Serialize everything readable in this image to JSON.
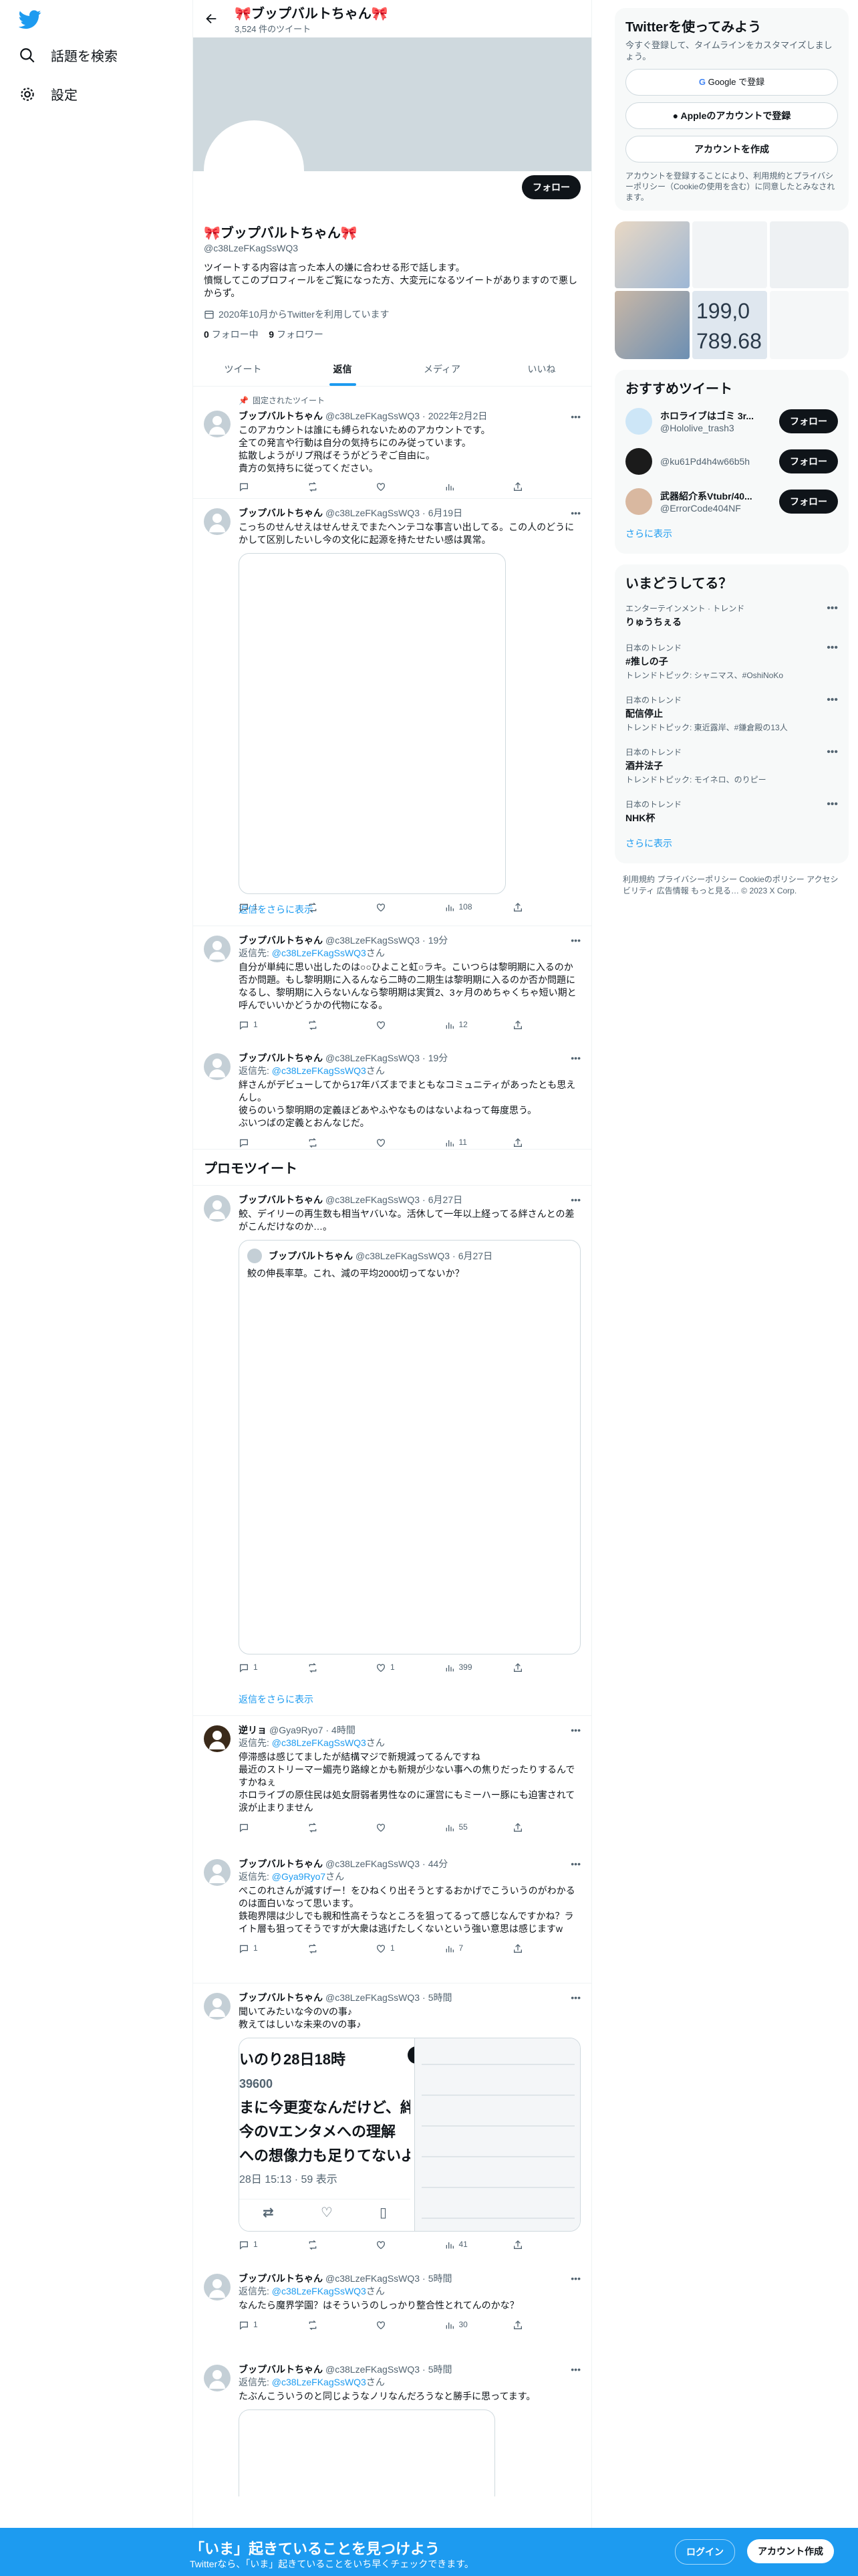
{
  "nav": {
    "explore": "話題を検索",
    "settings": "設定"
  },
  "header": {
    "name": "🎀ブップバルトちゃん🎀",
    "tweet_count": "3,524 件のツイート"
  },
  "profile": {
    "name": "🎀ブップバルトちゃん🎀",
    "handle": "@c38LzeFKagSsWQ3",
    "follow_button": "フォロー",
    "bio": "ツイートする内容は言った本人の嫌に合わせる形で話します。\n憤慨してこのプロフィールをご覧になった方、大変元になるツイートがありますので悪しからず。",
    "joined": "2020年10月からTwitterを利用しています",
    "following_count": "0",
    "following_label": "フォロー中",
    "followers_count": "9",
    "followers_label": "フォロワー"
  },
  "tabs": [
    "ツイート",
    "返信",
    "メディア",
    "いいね"
  ],
  "active_tab": "返信",
  "pinned_label": "固定されたツイート",
  "tweets": [
    {
      "name": "ブップバルトちゃん",
      "handle": "@c38LzeFKagSsWQ3",
      "time": "2022年2月2日",
      "reply_to": "",
      "text": "このアカウントは誰にも縛られないためのアカウントです。\n全ての発言や行動は自分の気持ちにのみ従っています。\n拡散しようがリプ飛ばそうがどうぞご自由に。\n貴方の気持ちに従ってください。",
      "replies": "",
      "retweets": "",
      "likes": "",
      "views": ""
    },
    {
      "name": "ブップバルトちゃん",
      "handle": "@c38LzeFKagSsWQ3",
      "time": "6月19日",
      "reply_to": "",
      "text": "こっちのせんせえはせんせえでまたヘンテコな事言い出してる。この人のどうにかして区別したいし今の文化に起源を持たせたい感は異常。",
      "replies": "1",
      "retweets": "",
      "likes": "",
      "views": "108"
    },
    {
      "name": "ブップバルトちゃん",
      "handle": "@c38LzeFKagSsWQ3",
      "time": "19分",
      "reply_to": "@c38LzeFKagSsWQ3",
      "text": "自分が単純に思い出したのは○○ひよこと虹○ラキ。こいつらは黎明期に入るのか否か問題。もし黎明期に入るんなら二時の二期生は黎明期に入るのか否か問題になるし、黎明期に入らないんなら黎明期は実質2、3ヶ月のめちゃくちゃ短い期と呼んでいいかどうかの代物になる。",
      "replies": "1",
      "retweets": "",
      "likes": "",
      "views": "12"
    },
    {
      "name": "ブップバルトちゃん",
      "handle": "@c38LzeFKagSsWQ3",
      "time": "19分",
      "reply_to": "@c38LzeFKagSsWQ3",
      "text": "絆さんがデビューしてから17年バズまでまともなコミュニティがあったとも思えんし。\n彼らのいう黎明期の定義ほどあやふやなものはないよねって毎度思う。\nぶいつばの定義とおんなじだ。",
      "replies": "",
      "retweets": "",
      "likes": "",
      "views": "11"
    },
    {
      "name": "ブップバルトちゃん",
      "handle": "@c38LzeFKagSsWQ3",
      "time": "6月27日",
      "reply_to": "",
      "text": "鮫、デイリーの再生数も相当ヤバいな。活休して一年以上経ってる絆さんとの差がこんだけなのか…。",
      "replies": "1",
      "retweets": "",
      "likes": "1",
      "views": "399"
    },
    {
      "name": "逆リョ",
      "handle": "@Gya9Ryo7",
      "time": "4時間",
      "reply_to": "@c38LzeFKagSsWQ3",
      "text": "停滞感は感じてましたが結構マジで新規減ってるんですね\n最近のストリーマー媚売り路線とかも新規が少ない事への焦りだったりするんですかねぇ\nホロライブの原住民は処女厨弱者男性なのに運営にもミーハー豚にも迫害されて涙が止まりません",
      "replies": "",
      "retweets": "",
      "likes": "",
      "views": "55"
    },
    {
      "name": "ブップバルトちゃん",
      "handle": "@c38LzeFKagSsWQ3",
      "time": "44分",
      "reply_to": "@Gya9Ryo7",
      "text": "ぺこのれさんが減すげー！をひねくり出そうとするおかげでこういうのがわかるのは面白いなって思います。\n鉄砲界隈は少しでも親和性高そうなところを狙ってるって感じなんですかね？ライト層も狙ってそうですが大衆は逃げたしくないという強い意思は感じますw",
      "replies": "1",
      "retweets": "",
      "likes": "1",
      "views": "7"
    },
    {
      "name": "ブップバルトちゃん",
      "handle": "@c38LzeFKagSsWQ3",
      "time": "5時間",
      "reply_to": "",
      "text": "聞いてみたいな今のVの事♪\n教えてはしいな未来のVの事♪",
      "replies": "1",
      "retweets": "",
      "likes": "",
      "views": "41"
    },
    {
      "name": "ブップバルトちゃん",
      "handle": "@c38LzeFKagSsWQ3",
      "time": "5時間",
      "reply_to": "@c38LzeFKagSsWQ3",
      "text": "なんたら魔界学園？はそういうのしっかり整合性とれてんのかな？",
      "replies": "1",
      "retweets": "",
      "likes": "",
      "views": "30"
    },
    {
      "name": "ブップバルトちゃん",
      "handle": "@c38LzeFKagSsWQ3",
      "time": "5時間",
      "reply_to": "@c38LzeFKagSsWQ3",
      "text": "たぶんこういうのと同じようなノリなんだろうなと勝手に思ってます。",
      "replies": "",
      "retweets": "",
      "likes": "",
      "views": ""
    }
  ],
  "quote": {
    "name": "ブップバルトちゃん",
    "handle": "@c38LzeFKagSsWQ3",
    "time": "6月27日",
    "text": "鮫の伸長率草。これ、減の平均2000切ってないか？"
  },
  "media_overlay": {
    "line1": "いのり28日18時",
    "line2": "39600",
    "line3": "まに今更変なんだけど、絆",
    "line4": "今のVエンタメへの理解",
    "line5": "への想像力も足りてないよ",
    "line6": "28日 15:13 · 59 表示"
  },
  "show_more": "返信をさらに表示",
  "promoted": "プロモツイート",
  "reply_label": "返信先:",
  "right": {
    "signup_title": "Twitterを使ってみよう",
    "signup_sub": "今すぐ登録して、タイムラインをカスタマイズしましょう。",
    "google": "Google で登録",
    "apple": "Appleのアカウントで登録",
    "create": "アカウントを作成",
    "terms": "アカウントを登録することにより、利用規約とプライバシーポリシー（Cookieの使用を含む）に同意したとみなされます。",
    "media_num1": "199,0",
    "media_num2": "789.68",
    "recommend_title": "おすすめツイート",
    "recommend": [
      {
        "name": "ホロライブはゴミ 3r...",
        "handle": "@Hololive_trash3",
        "button": "フォロー"
      },
      {
        "name": "",
        "handle": "@ku61Pd4h4w66b5h",
        "button": "フォロー"
      },
      {
        "name": "武器紹介系Vtubr/40...",
        "handle": "@ErrorCode404NF",
        "button": "フォロー"
      }
    ],
    "show_more": "さらに表示",
    "trends_title": "いまどうしてる？",
    "trends": [
      {
        "cat": "エンターテインメント · トレンド",
        "title": "りゅうちぇる",
        "extra": ""
      },
      {
        "cat": "日本のトレンド",
        "title": "#推しの子",
        "extra": "トレンドトピック: シャニマス、#OshiNoKo"
      },
      {
        "cat": "日本のトレンド",
        "title": "配信停止",
        "extra": "トレンドトピック: 東近露岸、#鎌倉殿の13人"
      },
      {
        "cat": "日本のトレンド",
        "title": "酒井法子",
        "extra": "トレンドトピック: モイネロ、のりピー"
      },
      {
        "cat": "日本のトレンド",
        "title": "NHK杯",
        "extra": ""
      }
    ],
    "footer": "利用規約 プライバシーポリシー Cookieのポリシー アクセシビリティ 広告情報 もっと見る… © 2023 X Corp."
  },
  "bottom": {
    "title": "「いま」起きていることを見つけよう",
    "sub": "Twitterなら、「いま」起きていることをいち早くチェックできます。",
    "login": "ログイン",
    "signup": "アカウント作成"
  },
  "colors": {
    "accent": "#1d9bf0",
    "text": "#0f1419",
    "muted": "#536471"
  }
}
